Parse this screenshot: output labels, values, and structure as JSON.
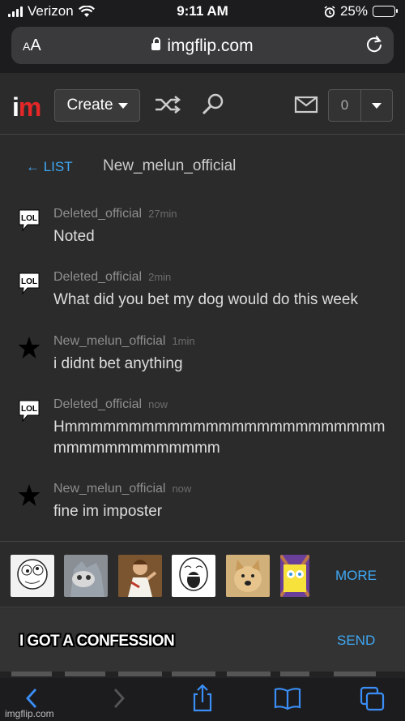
{
  "status_bar": {
    "carrier": "Verizon",
    "time": "9:11 AM",
    "battery": "25%",
    "battery_level": 0.25
  },
  "browser": {
    "aa_label": "AA",
    "url": "imgflip.com"
  },
  "nav": {
    "create_label": "Create",
    "notification_count": "0"
  },
  "conversation": {
    "back_label": "← LIST",
    "title": "New_melun_official"
  },
  "messages": [
    {
      "author": "Deleted_official",
      "time": "27min",
      "text": "Noted",
      "icon": "lol-icon"
    },
    {
      "author": "Deleted_official",
      "time": "2min",
      "text": "What did you bet my dog would do this week",
      "icon": "lol-icon"
    },
    {
      "author": "New_melun_official",
      "time": "1min",
      "text": "i didnt bet anything",
      "icon": "star-icon"
    },
    {
      "author": "Deleted_official",
      "time": "now",
      "text": "Hmmmmmmmmmmmmmmmmmmmmmmmmmmmmmmmmmmmmmm",
      "icon": "lol-icon"
    },
    {
      "author": "New_melun_official",
      "time": "now",
      "text": "fine im imposter",
      "icon": "star-icon"
    }
  ],
  "meme_picker": {
    "more_label": "MORE",
    "thumbnails": [
      "derp-meme",
      "unsettled-tom-meme",
      "buddy-christ-meme",
      "lol-rage-face-meme",
      "doge-meme",
      "imagination-spongebob-meme"
    ]
  },
  "composer": {
    "input_text": "I GOT A CONFESSION",
    "send_label": "SEND"
  },
  "watermark": "imgflip.com",
  "colors": {
    "link": "#3fa9f5",
    "brand_red": "#e52727",
    "background": "#2b2b2b"
  }
}
